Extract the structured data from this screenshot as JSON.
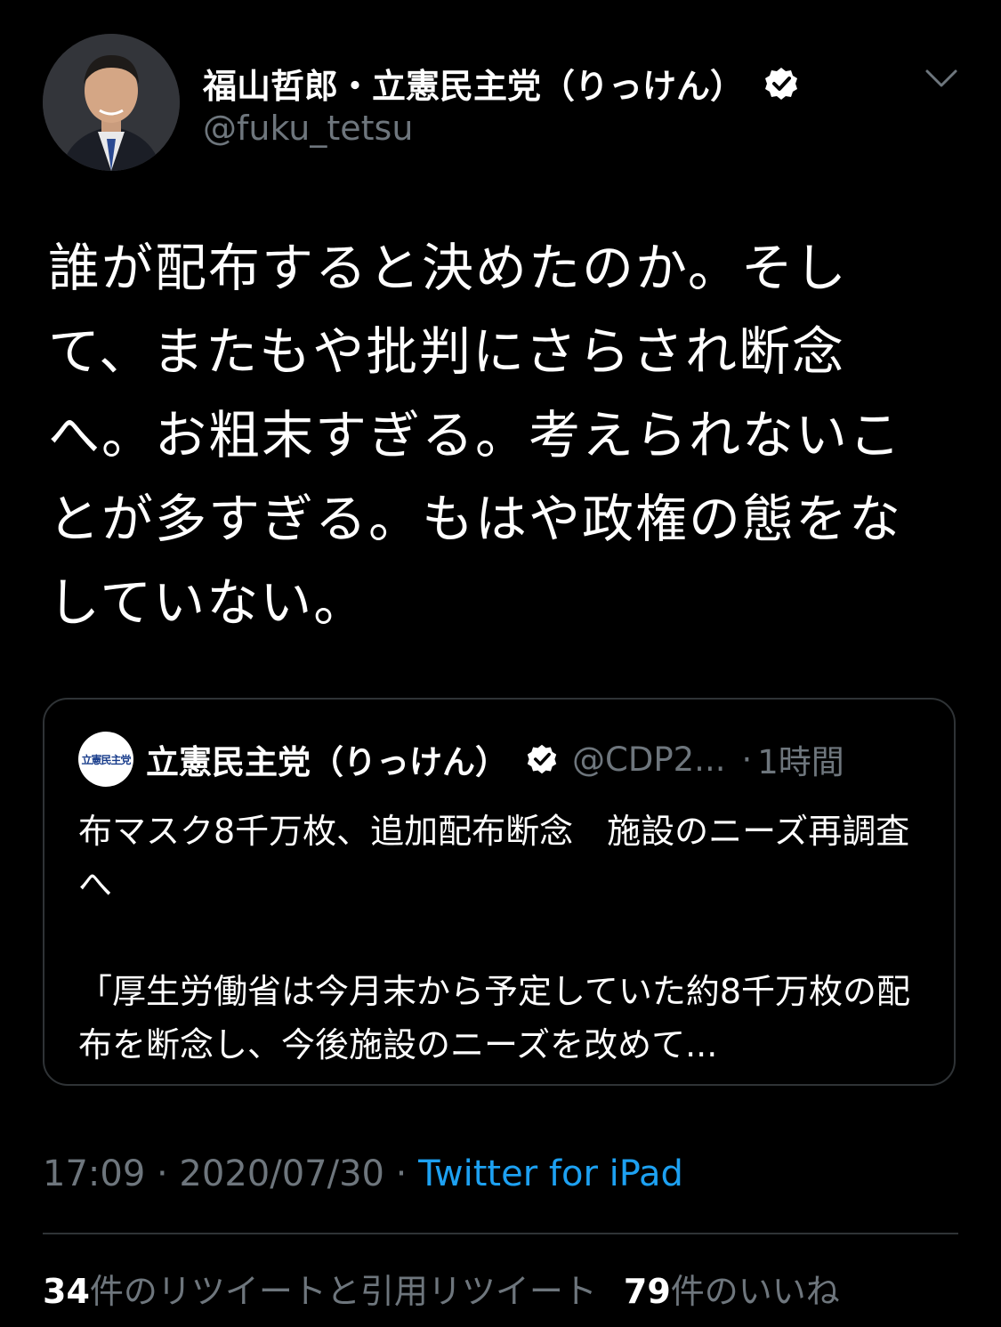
{
  "tweet": {
    "display_name": "福山哲郎・立憲民主党（りっけん）",
    "handle": "@fuku_tetsu",
    "text": "誰が配布すると決めたのか。そして、またもや批判にさらされ断念へ。お粗末すぎる。考えられないことが多すぎる。もはや政権の態をなしていない。",
    "timestamp": "17:09 · 2020/07/30 · ",
    "source": "Twitter for iPad",
    "icons": {
      "verified": "verified-badge-icon",
      "menu": "chevron-down-icon"
    }
  },
  "quote": {
    "avatar_text": "立憲民主党",
    "display_name": "立憲民主党（りっけん）",
    "handle": "@CDP2...",
    "separator": "·",
    "time": "1時間",
    "text": "布マスク8千万枚、追加配布断念　施設のニーズ再調査へ\n\n「厚生労働省は今月末から予定していた約8千万枚の配布を断念し、今後施設のニーズを改めて..."
  },
  "stats": {
    "retweet_count": "34",
    "retweet_label": "件のリツイートと引用リツイート",
    "like_count": "79",
    "like_label": "件のいいね"
  },
  "colors": {
    "background": "#000000",
    "text": "#ffffff",
    "muted": "#6e767d",
    "link": "#1da1f2",
    "border": "#2f3336"
  }
}
